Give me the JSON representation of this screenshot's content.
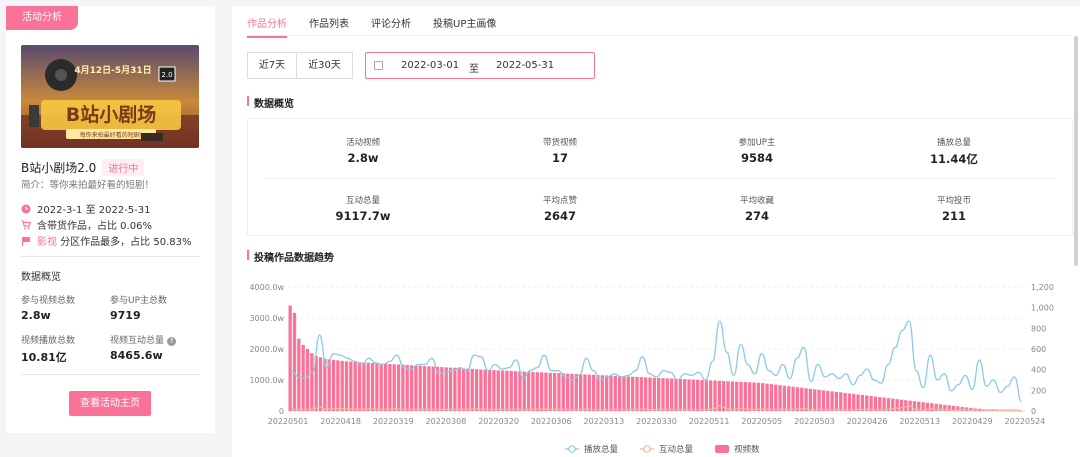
{
  "left": {
    "tag": "活动分析",
    "banner_lines": [
      "4月12日-5月31日",
      "B站小剧场",
      "每你来拍最好看的短剧!"
    ],
    "banner_corner": "2.0",
    "title": "B站小剧场2.0",
    "status": "进行中",
    "desc": "简介：等你来拍最好看的短剧！",
    "date_range": "2022-3-1 至 2022-5-31",
    "goods_info": "含带货作品，占比 0.06%",
    "zone_highlight": "影视",
    "zone_info": "分区作品最多，占比 50.83%",
    "section_title": "数据概览",
    "stats": [
      {
        "label": "参与视频总数",
        "value": "2.8w"
      },
      {
        "label": "参与UP主总数",
        "value": "9719"
      },
      {
        "label": "视频播放总数",
        "value": "10.81亿"
      },
      {
        "label": "视频互动总量",
        "value": "8465.6w"
      }
    ],
    "button": "查看活动主页"
  },
  "tabs": [
    "作品分析",
    "作品列表",
    "评论分析",
    "投稿UP主画像"
  ],
  "range_buttons": [
    "近7天",
    "近30天"
  ],
  "date_start": "2022-03-01",
  "date_sep": "至",
  "date_end": "2022-05-31",
  "overview_title": "数据概览",
  "overview": [
    {
      "label": "活动视频",
      "value": "2.8w"
    },
    {
      "label": "带货视频",
      "value": "17"
    },
    {
      "label": "参加UP主",
      "value": "9584"
    },
    {
      "label": "播放总量",
      "value": "11.44亿"
    },
    {
      "label": "互动总量",
      "value": "9117.7w"
    },
    {
      "label": "平均点赞",
      "value": "2647"
    },
    {
      "label": "平均收藏",
      "value": "274"
    },
    {
      "label": "平均投币",
      "value": "211"
    }
  ],
  "trend_title": "投稿作品数据趋势",
  "accent": "#fb7299",
  "chart_data": {
    "type": "bar",
    "left_axis_ticks": [
      "4000.0w",
      "3000.0w",
      "2000.0w",
      "1000.0w",
      "0"
    ],
    "right_axis_ticks": [
      "1,200",
      "1,000",
      "800",
      "600",
      "400",
      "200",
      "0"
    ],
    "ylim_left": [
      0,
      4000
    ],
    "ylim_right": [
      0,
      1200
    ],
    "x_tick_labels": [
      "20220501",
      "20220418",
      "20220319",
      "20220308",
      "20220320",
      "20220306",
      "20220313",
      "20220330",
      "20220511",
      "20220505",
      "20220503",
      "20220426",
      "20220513",
      "20220429",
      "20220524"
    ],
    "series": [
      {
        "name": "播放总量",
        "color": "#8ccbe4",
        "values": [
          1300,
          1100,
          1050,
          1250,
          2450,
          1400,
          1850,
          1800,
          1700,
          1600,
          1500,
          1700,
          1550,
          1500,
          1600,
          1800,
          1400,
          1350,
          1500,
          1500,
          1700,
          1200,
          1250,
          1300,
          1400,
          1300,
          1800,
          1750,
          1300,
          1500,
          1350,
          1400,
          1650,
          1050,
          1300,
          1400,
          1800,
          1300,
          1300,
          1100,
          1000,
          1150,
          1700,
          1300,
          1000,
          1100,
          1200,
          1100,
          1150,
          1300,
          1750,
          1200,
          1100,
          1300,
          1250,
          1000,
          1200,
          1150,
          1250,
          1000,
          1600,
          2900,
          1900,
          1150,
          2150,
          1500,
          1200,
          1850,
          1300,
          1150,
          1500,
          1050,
          1700,
          2050,
          950,
          1500,
          1100,
          1200,
          1050,
          1200,
          850,
          1150,
          1350,
          1000,
          900,
          1500,
          2050,
          2600,
          2900,
          1300,
          750,
          1800,
          1000,
          1200,
          650,
          850,
          1150,
          700,
          1650,
          800,
          1000,
          600,
          800,
          1100,
          300
        ]
      },
      {
        "name": "互动总量",
        "color": "#f5b891",
        "values": [
          55,
          45,
          50,
          50,
          120,
          55,
          80,
          75,
          70,
          60,
          55,
          70,
          60,
          55,
          60,
          70,
          55,
          50,
          55,
          55,
          60,
          45,
          50,
          50,
          55,
          50,
          70,
          65,
          50,
          55,
          50,
          55,
          60,
          40,
          50,
          55,
          70,
          50,
          50,
          45,
          40,
          45,
          60,
          50,
          40,
          45,
          50,
          45,
          45,
          50,
          65,
          45,
          45,
          50,
          50,
          40,
          45,
          45,
          50,
          40,
          60,
          160,
          80,
          45,
          90,
          55,
          45,
          70,
          50,
          45,
          55,
          40,
          65,
          85,
          35,
          55,
          40,
          45,
          40,
          45,
          35,
          45,
          50,
          40,
          35,
          55,
          85,
          110,
          170,
          50,
          30,
          70,
          40,
          45,
          25,
          35,
          45,
          30,
          60,
          30,
          40,
          25,
          30,
          40,
          10
        ]
      },
      {
        "name": "视频数",
        "color": "#fb7299",
        "values": [
          1020,
          950,
          700,
          640,
          600,
          560,
          530,
          520,
          505,
          500,
          495,
          490,
          485,
          480,
          478,
          475,
          472,
          470,
          468,
          465,
          462,
          460,
          458,
          455,
          452,
          450,
          448,
          445,
          442,
          440,
          438,
          435,
          432,
          430,
          428,
          425,
          422,
          420,
          418,
          415,
          412,
          410,
          408,
          405,
          402,
          400,
          398,
          396,
          394,
          392,
          390,
          388,
          386,
          384,
          382,
          380,
          378,
          376,
          374,
          372,
          370,
          368,
          366,
          364,
          362,
          360,
          358,
          356,
          354,
          352,
          350,
          348,
          346,
          344,
          342,
          340,
          338,
          336,
          334,
          332,
          330,
          328,
          326,
          324,
          322,
          320,
          318,
          316,
          314,
          312,
          310,
          308,
          306,
          304,
          302,
          300,
          298,
          296,
          294,
          292,
          290,
          288,
          286,
          284,
          282,
          280,
          278,
          276,
          274,
          270,
          265,
          260,
          255,
          250,
          245,
          240,
          235,
          230,
          225,
          220,
          215,
          210,
          205,
          200,
          195,
          190,
          185,
          180,
          175,
          170,
          165,
          160,
          155,
          150,
          145,
          140,
          135,
          130,
          125,
          120,
          115,
          110,
          105,
          100,
          95,
          90,
          85,
          80,
          75,
          70,
          65,
          60,
          55,
          50,
          45,
          40,
          35,
          30,
          25,
          20,
          15,
          10,
          8,
          6,
          4,
          2,
          1,
          1,
          1,
          1
        ]
      }
    ]
  }
}
